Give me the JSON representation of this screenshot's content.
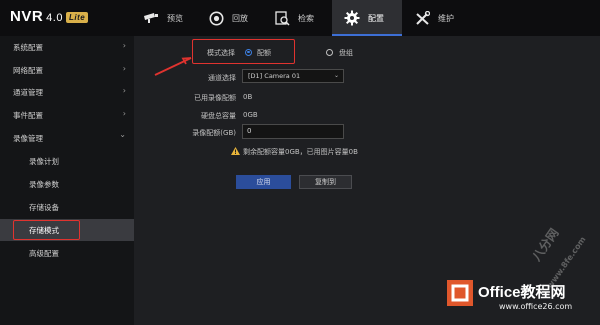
{
  "brand": {
    "name": "NVR",
    "version": "4.0",
    "badge": "Lite"
  },
  "tabs": [
    {
      "label": "预览",
      "icon": "camera-icon"
    },
    {
      "label": "回放",
      "icon": "playback-icon"
    },
    {
      "label": "检索",
      "icon": "search-icon"
    },
    {
      "label": "配置",
      "icon": "gear-icon",
      "active": true
    },
    {
      "label": "维护",
      "icon": "tools-icon"
    }
  ],
  "sidebar": {
    "items": [
      {
        "label": "系统配置",
        "chevron": "›"
      },
      {
        "label": "网络配置",
        "chevron": "›"
      },
      {
        "label": "通道管理",
        "chevron": "›"
      },
      {
        "label": "事件配置",
        "chevron": "›"
      },
      {
        "label": "录像管理",
        "chevron": "⌄"
      },
      {
        "label": "录像计划"
      },
      {
        "label": "录像参数"
      },
      {
        "label": "存储设备"
      },
      {
        "label": "存储模式",
        "active": true
      },
      {
        "label": "高级配置"
      }
    ]
  },
  "main": {
    "mode_label": "模式选择",
    "mode_quota": "配额",
    "mode_group": "盘组",
    "mode_selected": "配额",
    "channel_label": "通道选择",
    "channel_value": "[D1] Camera 01",
    "used_quota_label": "已用录像配额",
    "used_quota_value": "0B",
    "disk_capacity_label": "硬盘总容量",
    "disk_capacity_value": "0GB",
    "record_quota_label": "录像配额(GB)",
    "record_quota_value": "0",
    "warning_text": "剩余配额容量0GB，已用图片容量0B",
    "apply_label": "应用",
    "copy_label": "复制到"
  },
  "watermark": {
    "text1": "八分网",
    "text2": "www.8fe.com",
    "site": "Office教程网",
    "url": "www.office26.com"
  },
  "colors": {
    "accent": "#3d6fd6",
    "highlight_red": "#e0332f",
    "apply_button": "#2b4d9b",
    "office_orange": "#e0572c"
  }
}
